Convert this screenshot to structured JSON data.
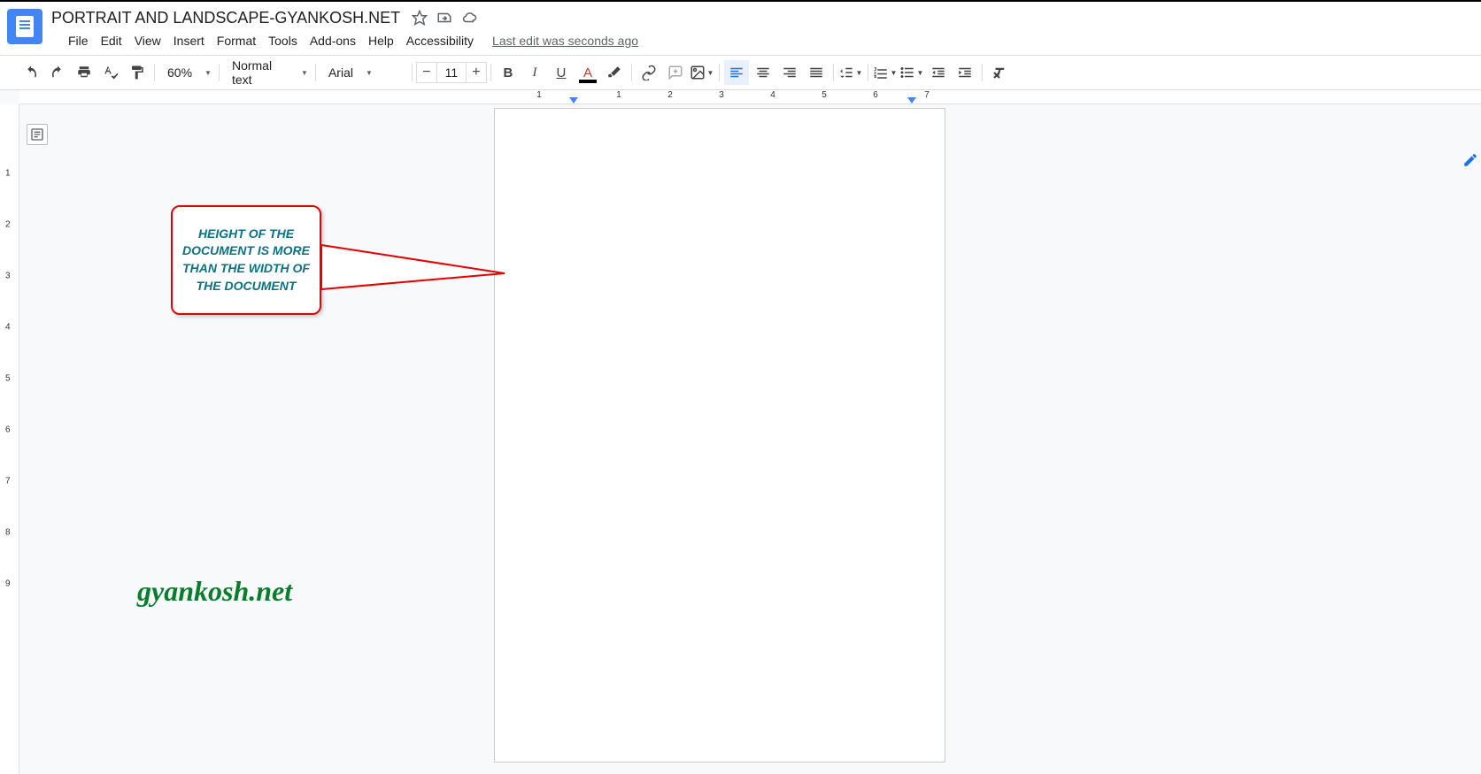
{
  "title": "PORTRAIT AND LANDSCAPE-GYANKOSH.NET",
  "menus": [
    "File",
    "Edit",
    "View",
    "Insert",
    "Format",
    "Tools",
    "Add-ons",
    "Help",
    "Accessibility"
  ],
  "last_edit": "Last edit was seconds ago",
  "toolbar": {
    "zoom": "60%",
    "style": "Normal text",
    "font": "Arial",
    "font_size": "11"
  },
  "ruler_h": [
    "1",
    "1",
    "2",
    "3",
    "4",
    "5",
    "6",
    "7"
  ],
  "ruler_v": [
    "1",
    "2",
    "3",
    "4",
    "5",
    "6",
    "7",
    "8",
    "9"
  ],
  "callout_text": "HEIGHT OF THE DOCUMENT IS MORE THAN THE WIDTH OF THE DOCUMENT",
  "watermark": "gyankosh.net"
}
